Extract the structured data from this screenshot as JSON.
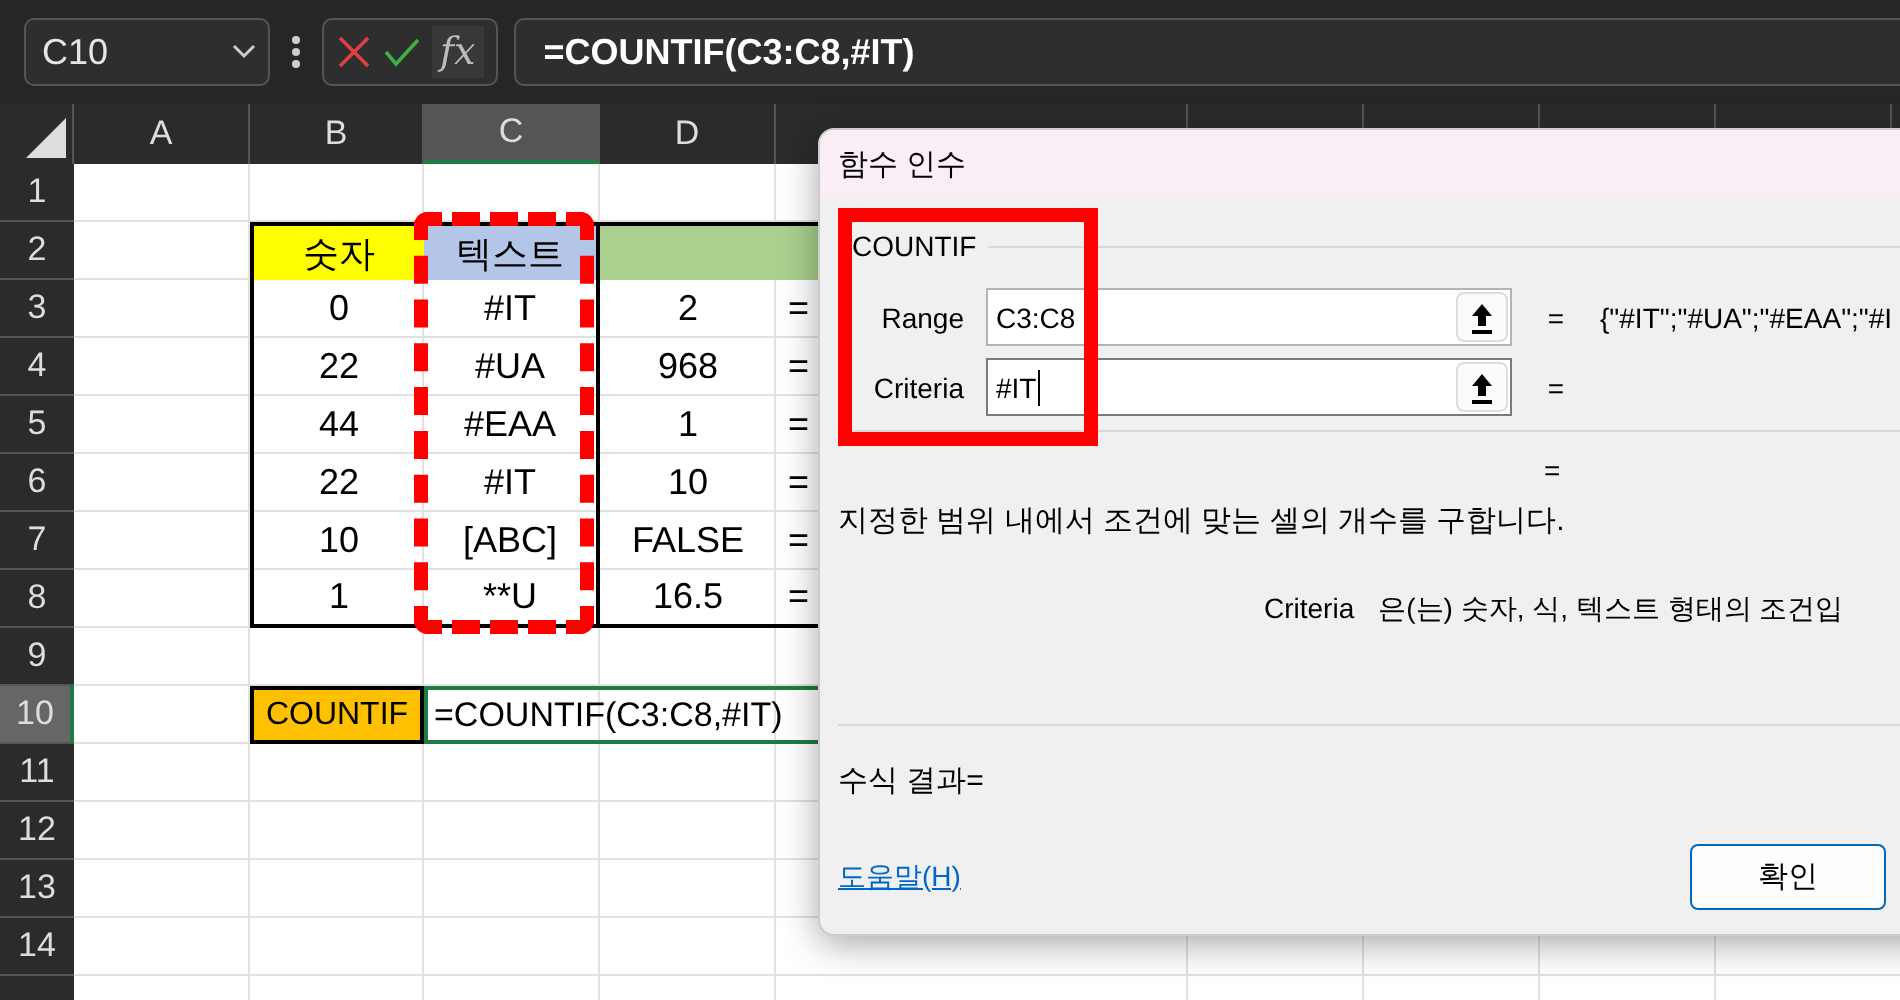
{
  "formula_bar": {
    "name_box": "C10",
    "fx": "fx",
    "formula": "=COUNTIF(C3:C8,#IT)"
  },
  "columns": [
    {
      "label": "A",
      "selected": false
    },
    {
      "label": "B",
      "selected": false
    },
    {
      "label": "C",
      "selected": true
    },
    {
      "label": "D",
      "selected": false
    }
  ],
  "rows": [
    {
      "label": "1",
      "selected": false
    },
    {
      "label": "2",
      "selected": false
    },
    {
      "label": "3",
      "selected": false
    },
    {
      "label": "4",
      "selected": false
    },
    {
      "label": "5",
      "selected": false
    },
    {
      "label": "6",
      "selected": false
    },
    {
      "label": "7",
      "selected": false
    },
    {
      "label": "8",
      "selected": false
    },
    {
      "label": "9",
      "selected": false
    },
    {
      "label": "10",
      "selected": true
    },
    {
      "label": "11",
      "selected": false
    },
    {
      "label": "12",
      "selected": false
    },
    {
      "label": "13",
      "selected": false
    },
    {
      "label": "14",
      "selected": false
    }
  ],
  "table": {
    "headers": [
      {
        "text": "숫자",
        "color": "#ffff00"
      },
      {
        "text": "텍스트",
        "color": "#b4c6e7"
      },
      {
        "color": "#a9d08e"
      }
    ],
    "rows": [
      {
        "number": "0",
        "text": "#IT",
        "value": "2",
        "result": "="
      },
      {
        "number": "22",
        "text": "#UA",
        "value": "968",
        "result": "="
      },
      {
        "number": "44",
        "text": "#EAA",
        "value": "1",
        "result": "="
      },
      {
        "number": "22",
        "text": "#IT",
        "value": "10",
        "result": "="
      },
      {
        "number": "10",
        "text": "[ABC]",
        "value": "FALSE",
        "result": "="
      },
      {
        "number": "1",
        "text": "**U",
        "value": "16.5",
        "result": "="
      }
    ]
  },
  "countif_row": {
    "label": "COUNTIF",
    "color": "#ffc000",
    "formula": "=COUNTIF(C3:C8,#IT)"
  },
  "dialog": {
    "title": "함수 인수",
    "function": "COUNTIF",
    "args": [
      {
        "label": "Range",
        "value": "C3:C8",
        "equals": "=",
        "result": "{\"#IT\";\"#UA\";\"#EAA\";\"#I",
        "focused": false
      },
      {
        "label": "Criteria",
        "value": "#IT",
        "equals": "=",
        "focused": true
      }
    ],
    "result_equals": "=",
    "description": "지정한 범위 내에서 조건에 맞는 셀의 개수를 구합니다.",
    "arg_help": {
      "name": "Criteria",
      "text": "은(는) 숫자, 식, 텍스트 형태의 조건입"
    },
    "formula_result": "수식 결과=",
    "help_link": "도움말(H)",
    "ok_button": "확인"
  }
}
